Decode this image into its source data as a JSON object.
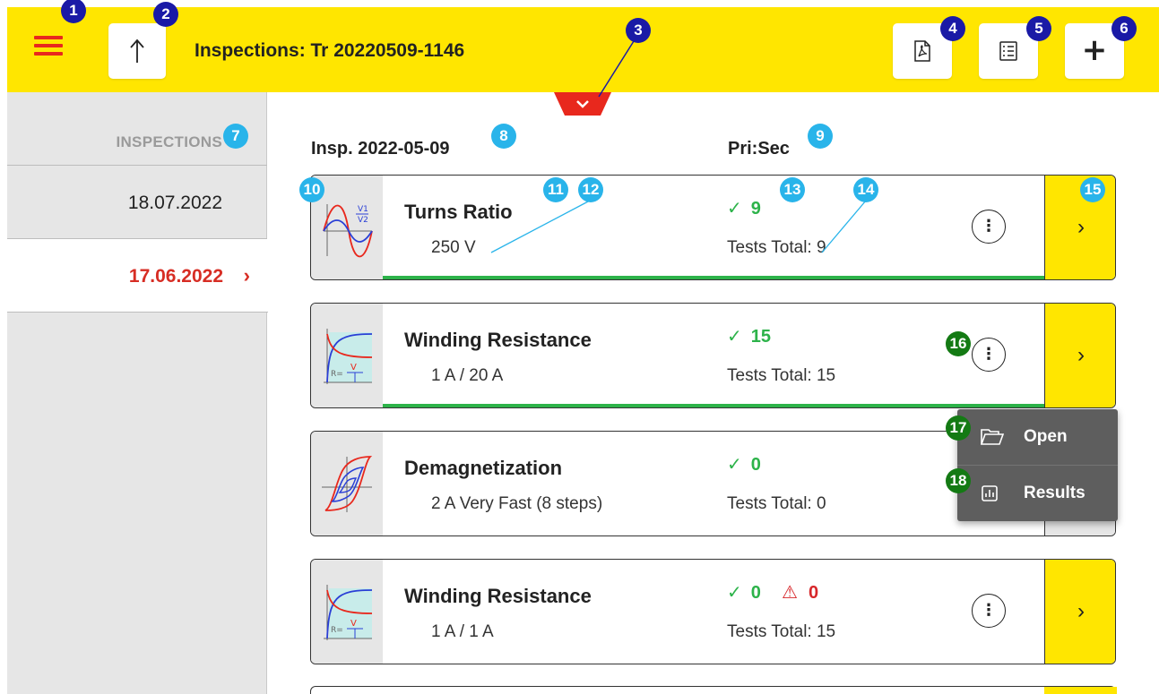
{
  "header": {
    "title": "Inspections: Tr 20220509-1146",
    "icons": [
      "menu-icon",
      "up-arrow-icon",
      "pdf-icon",
      "checklist-icon",
      "plus-icon"
    ],
    "add_label": "+",
    "accent_color": "#ffe600",
    "brand_red": "#e8281d"
  },
  "sidebar": {
    "heading": "INSPECTIONS",
    "items": [
      {
        "label": "18.07.2022",
        "active": false
      },
      {
        "label": "17.06.2022",
        "active": true,
        "chevron": "›"
      }
    ]
  },
  "columns": {
    "insp_label": "Insp. 2022-05-09",
    "pri_sec_label": "Pri:Sec"
  },
  "cards": [
    {
      "name": "Turns Ratio",
      "param": "250 V",
      "ok_count": "9",
      "warn_count": "",
      "total": "Tests Total: 9",
      "icon": "turns-ratio-icon",
      "go": "›"
    },
    {
      "name": "Winding Resistance",
      "param": "1 A / 20 A",
      "ok_count": "15",
      "warn_count": "",
      "total": "Tests Total: 15",
      "icon": "winding-resistance-icon",
      "go": "›"
    },
    {
      "name": "Demagnetization",
      "param": "2 A Very Fast (8 steps)",
      "ok_count": "0",
      "warn_count": "",
      "total": "Tests Total: 0",
      "icon": "demagnetization-icon",
      "go": "›"
    },
    {
      "name": "Winding Resistance",
      "param": "1 A / 1 A",
      "ok_count": "0",
      "warn_count": "0",
      "total": "Tests Total: 15",
      "icon": "winding-resistance-icon",
      "go": "›"
    }
  ],
  "status": {
    "tick": "✓",
    "warn": "⚠",
    "menu": "⋮"
  },
  "context_menu": {
    "items": [
      {
        "label": "Open",
        "icon": "folder-open-icon"
      },
      {
        "label": "Results",
        "icon": "results-chart-icon"
      }
    ]
  },
  "callouts": [
    "1",
    "2",
    "3",
    "4",
    "5",
    "6",
    "7",
    "8",
    "9",
    "10",
    "11",
    "12",
    "13",
    "14",
    "15",
    "16",
    "17",
    "18"
  ],
  "colors": {
    "ok": "#2db34a",
    "warn": "#d7262a",
    "callout_navy": "#1a1aa6",
    "callout_cyan": "#29b4ea",
    "callout_green": "#147a14"
  }
}
